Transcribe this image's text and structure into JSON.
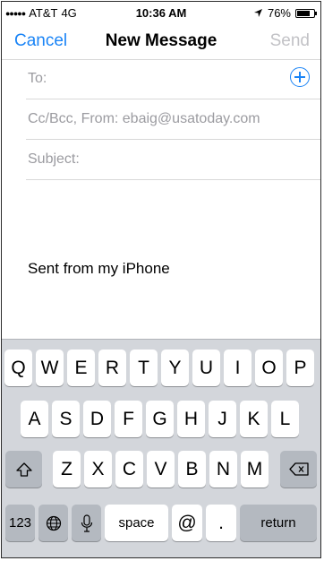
{
  "status_bar": {
    "signal_dots": "●●●●●",
    "carrier": "AT&T",
    "network": "4G",
    "time": "10:36 AM",
    "location_icon": "location-arrow-icon",
    "battery_text": "76%",
    "battery_level": 0.76
  },
  "nav": {
    "cancel_label": "Cancel",
    "title": "New Message",
    "send_label": "Send"
  },
  "fields": {
    "to_label": "To:",
    "cc_label": "Cc/Bcc, From: ebaig@usatoday.com",
    "subject_label": "Subject:",
    "add_icon": "add-contact-icon"
  },
  "body": {
    "signature": "Sent from my iPhone"
  },
  "keyboard": {
    "row1": [
      "Q",
      "W",
      "E",
      "R",
      "T",
      "Y",
      "U",
      "I",
      "O",
      "P"
    ],
    "row2": [
      "A",
      "S",
      "D",
      "F",
      "G",
      "H",
      "J",
      "K",
      "L"
    ],
    "row3": [
      "Z",
      "X",
      "C",
      "V",
      "B",
      "N",
      "M"
    ],
    "shift_icon": "shift-icon",
    "delete_icon": "delete-icon",
    "numbers_label": "123",
    "globe_icon": "globe-icon",
    "mic_icon": "microphone-icon",
    "space_label": "space",
    "at_label": "@",
    "period_label": ".",
    "return_label": "return"
  },
  "colors": {
    "accent": "#1a84f6",
    "disabled": "#c2c2c6",
    "placeholder": "#9b9ba0",
    "keyboard_bg": "#d3d6db"
  }
}
